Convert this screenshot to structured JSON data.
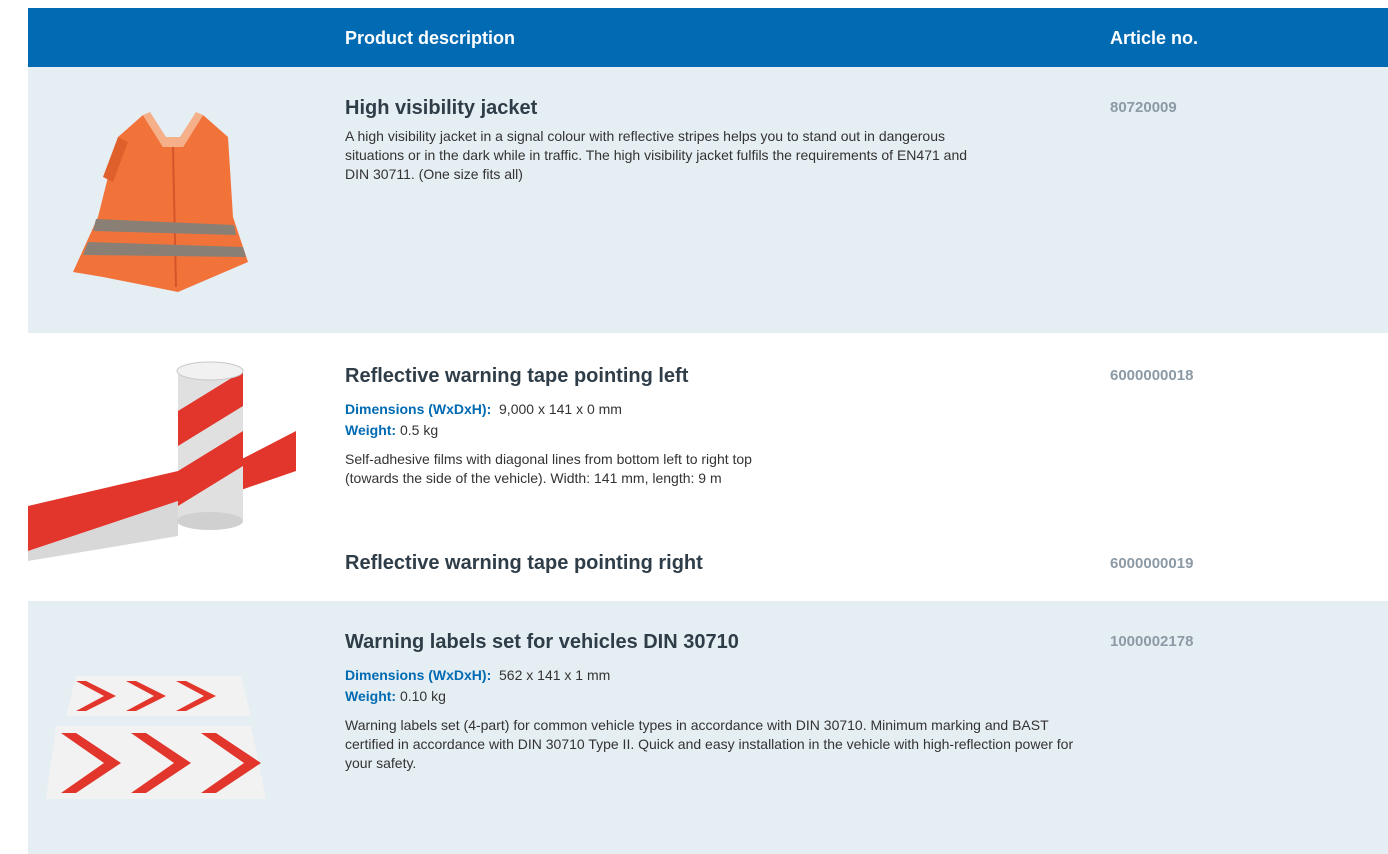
{
  "header": {
    "col_description": "Product description",
    "col_article": "Article no."
  },
  "products": [
    {
      "title": "High visibility jacket",
      "article_no": "80720009",
      "description": "A high visibility jacket in a signal colour with reflective stripes helps you to stand out in dangerous situations or in the dark while in traffic. The high visibility jacket fulfils the requirements of EN471 and DIN 30711. (One size fits all)",
      "image_icon": "safety-vest-icon"
    },
    {
      "title": "Reflective warning tape pointing left",
      "article_no": "6000000018",
      "dimensions_label": "Dimensions (WxDxH):",
      "dimensions_value": "9,000 x 141 x 0 mm",
      "weight_label": "Weight:",
      "weight_value": "0.5 kg",
      "description": "Self-adhesive films with diagonal lines from bottom left to right top (towards the side of the vehicle). Width: 141 mm, length: 9 m",
      "image_icon": "warning-tape-roll-icon"
    },
    {
      "title": "Reflective warning tape pointing right",
      "article_no": "6000000019"
    },
    {
      "title": "Warning labels set for vehicles DIN 30710",
      "article_no": "1000002178",
      "dimensions_label": "Dimensions (WxDxH):",
      "dimensions_value": "562 x 141 x 1 mm",
      "weight_label": "Weight:",
      "weight_value": "0.10 kg",
      "description": "Warning labels set (4-part) for common vehicle types in accordance with DIN 30710. Minimum marking and BAST certified in accordance with DIN 30710 Type II. Quick and easy installation in the vehicle with high-reflection power for your safety.",
      "image_icon": "chevron-warning-labels-icon"
    }
  ],
  "colors": {
    "header_blue": "#006ab3",
    "row_shade": "#e5eef3",
    "title_text": "#2f3d48",
    "article_grey": "#8c9aa5"
  }
}
